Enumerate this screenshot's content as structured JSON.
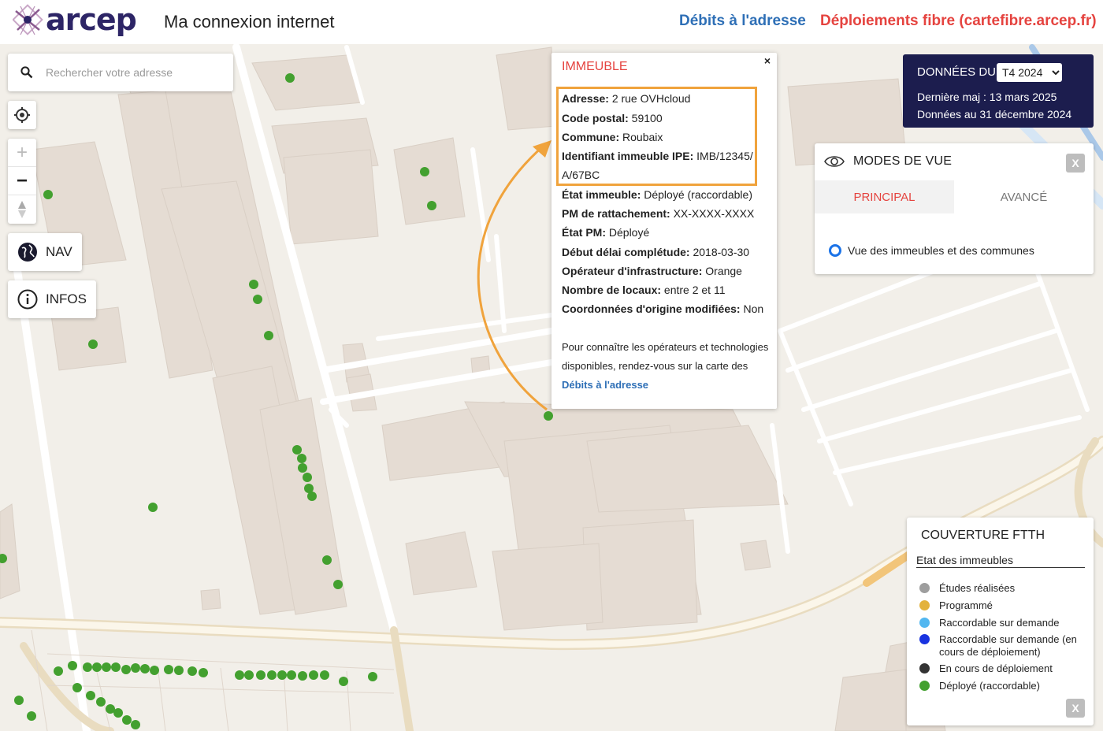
{
  "header": {
    "logo_text": "arcep",
    "app_title": "Ma connexion internet",
    "link_debits": "Débits à l'adresse",
    "link_deploiements": "Déploiements fibre (cartefibre.arcep.fr)"
  },
  "search": {
    "placeholder": "Rechercher votre adresse"
  },
  "controls": {
    "zoom_in": "+",
    "zoom_out": "−",
    "nav_label": "NAV",
    "infos_label": "INFOS"
  },
  "popup": {
    "title": "IMMEUBLE",
    "close": "×",
    "fields": [
      {
        "label": "Adresse:",
        "value": "2 rue OVHcloud"
      },
      {
        "label": "Code postal:",
        "value": "59100"
      },
      {
        "label": "Commune:",
        "value": "Roubaix"
      },
      {
        "label": "Identifiant immeuble IPE:",
        "value": "IMB/12345/"
      },
      {
        "label": "",
        "value": "A/67BC"
      },
      {
        "label": "État immeuble:",
        "value": "Déployé (raccordable)"
      },
      {
        "label": "PM de rattachement:",
        "value": "XX-XXXX-XXXX"
      },
      {
        "label": "État PM:",
        "value": "Déployé"
      },
      {
        "label": "Début délai complétude:",
        "value": "2018-03-30"
      },
      {
        "label": "Opérateur d'infrastructure:",
        "value": "Orange"
      },
      {
        "label": "Nombre de locaux:",
        "value": "entre 2 et 11"
      },
      {
        "label": "Coordonnées d'origine modifiées:",
        "value": "Non"
      }
    ],
    "note_text": "Pour connaître les opérateurs et technologies disponibles, rendez-vous sur la carte des ",
    "note_link": "Débits à l'adresse"
  },
  "data_panel": {
    "title": "DONNÉES DU",
    "selected_period": "T4 2024",
    "last_update": "Dernière maj : 13 mars 2025",
    "data_as_of": "Données au 31 décembre 2024"
  },
  "modes": {
    "title": "MODES DE VUE",
    "close": "X",
    "tab_principal": "PRINCIPAL",
    "tab_avance": "AVANCÉ",
    "radio_label": "Vue des immeubles et des communes"
  },
  "legend": {
    "title": "COUVERTURE FTTH",
    "subtitle": "Etat des immeubles",
    "close": "X",
    "items": [
      {
        "label": "Études réalisées",
        "color": "#9e9e9e"
      },
      {
        "label": "Programmé",
        "color": "#e3b23c"
      },
      {
        "label": "Raccordable sur demande",
        "color": "#52b7f0"
      },
      {
        "label": "Raccordable sur demande (en cours de déploiement)",
        "color": "#1933e0"
      },
      {
        "label": "En cours de déploiement",
        "color": "#333333"
      },
      {
        "label": "Déployé (raccordable)",
        "color": "#43a02f"
      }
    ]
  },
  "colors": {
    "accent_red": "#e5433f",
    "accent_blue": "#2e6fb6",
    "panel_navy": "#1c1d4e",
    "highlight_orange": "#f0a33c",
    "deployed_green": "#43a02f"
  }
}
